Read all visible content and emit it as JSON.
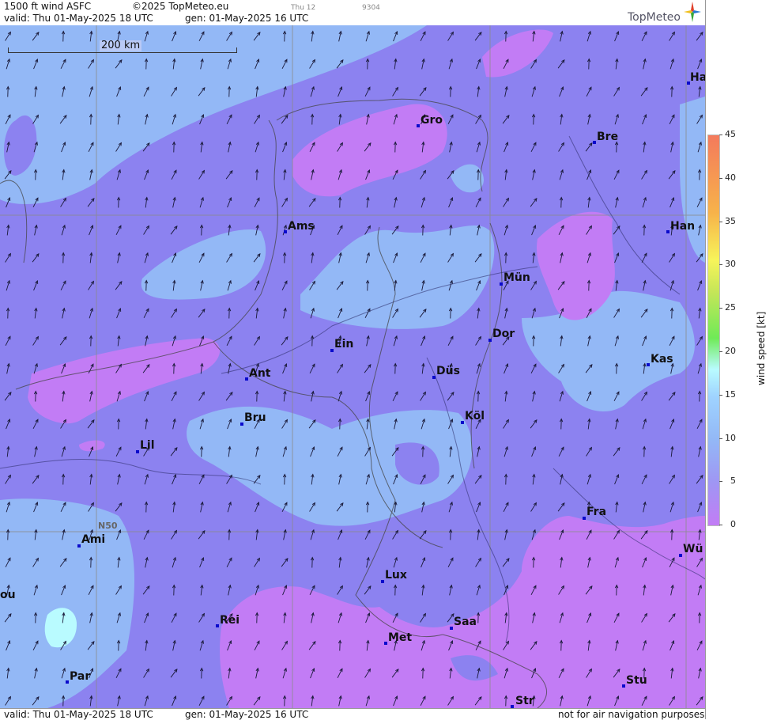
{
  "header": {
    "product": "1500 ft wind ASFC",
    "copyright": "©2025 TopMeteo.eu",
    "run_label": "Thu 12",
    "code": "9304",
    "valid": "valid:  Thu  01-May-2025  18 UTC",
    "generated": "gen: 01-May-2025 16 UTC",
    "brand": "TopMeteo"
  },
  "footer": {
    "valid": "valid:  Thu  01-May-2025  18 UTC",
    "generated": "gen: 01-May-2025 16 UTC",
    "disclaimer": "not for air navigation purposes"
  },
  "map": {
    "scale_label": "200 km",
    "lat_label": "N50",
    "cities": [
      {
        "name": "Ha"
      },
      {
        "name": "Gro"
      },
      {
        "name": "Bre"
      },
      {
        "name": "Ams"
      },
      {
        "name": "Han"
      },
      {
        "name": "Mün"
      },
      {
        "name": "Dor"
      },
      {
        "name": "Ein"
      },
      {
        "name": "Kas"
      },
      {
        "name": "Ant"
      },
      {
        "name": "Düs"
      },
      {
        "name": "Bru"
      },
      {
        "name": "Köl"
      },
      {
        "name": "Lil"
      },
      {
        "name": "Fra"
      },
      {
        "name": "Ami"
      },
      {
        "name": "Wü"
      },
      {
        "name": "Lux"
      },
      {
        "name": "ou"
      },
      {
        "name": "Rei"
      },
      {
        "name": "Saa"
      },
      {
        "name": "Met"
      },
      {
        "name": "Par"
      },
      {
        "name": "Stu"
      },
      {
        "name": "Str"
      }
    ],
    "colors": {
      "calm": "#c27cf5",
      "light": "#8c82f0",
      "moderate": "#93b8f6",
      "fresh": "#b9fbff"
    }
  },
  "legend": {
    "ticks": [
      "45",
      "40",
      "35",
      "30",
      "25",
      "20",
      "15",
      "10",
      "5",
      "0"
    ],
    "label": "wind  speed  [kt]"
  }
}
